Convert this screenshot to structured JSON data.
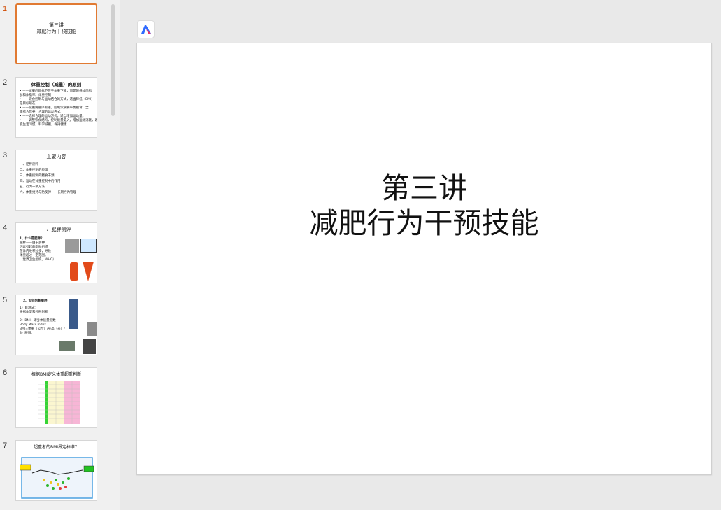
{
  "thumbnails": [
    {
      "num": "1",
      "title": "第三讲",
      "lines": [
        "减肥行为干预技能"
      ],
      "active": true
    },
    {
      "num": "2",
      "title": "体重控制（减重）的原则",
      "lines": [
        "• ——减肥的目标不在于体重下降，而是降低体内脂",
        "肪和体脂率。体重控制",
        "• ——饮食控制与运动结合的方式，适当降低（BMI）",
        "是目标所在",
        "• ——减肥要循序渐进，控制饮食要平衡膳食，全",
        "面综合营养，合理的运动方式",
        "• ——选择合理的运动方式，适当增加运动量。",
        "• ——调整饮食结构，控制能量摄入，增加运动消耗，改",
        "变生活习惯，科学减肥，保持健康"
      ],
      "active": false
    },
    {
      "num": "3",
      "title": "主要内容",
      "lines": [
        "一、肥胖测评",
        "二、体重控制的原理",
        "三、体重控制的膳食干预",
        "四、运动在体重控制中的作用",
        "五、行为干预方法",
        "六、体重维持与防反弹——长期行为管理"
      ],
      "active": false
    },
    {
      "num": "4",
      "title": "一、肥胖测评",
      "lines": [
        "1、什么是肥胖？",
        "肥胖——由于多种",
        "因素引起的脂肪组织",
        "在体内堆积过多，导致",
        "体重超过一定范围。",
        "（世界卫生组织，WHO）"
      ],
      "active": false
    },
    {
      "num": "5",
      "title": "2、如何判断肥胖",
      "lines": [
        "1）目测法：",
        "根据体型和外形判断",
        "2）BMI：即身体质量指数",
        "Body Mass Index",
        "BMI=体重（公斤）/身高（米）²",
        "3）腰围："
      ],
      "active": false
    },
    {
      "num": "6",
      "title": "根据BMI定义体重超重判断",
      "lines": [],
      "active": false
    },
    {
      "num": "7",
      "title": "超重者的BMI界定标准？",
      "lines": [],
      "active": false
    }
  ],
  "brand_icon": "presentation-app-logo-icon",
  "slide": {
    "title_line1": "第三讲",
    "title_line2": "减肥行为干预技能"
  },
  "colors": {
    "accent": "#e17a32",
    "active_num": "#d04a02",
    "pane": "#f0f0f0",
    "canvas": "#e9e9e9",
    "brand_blue": "#2f6bff"
  }
}
